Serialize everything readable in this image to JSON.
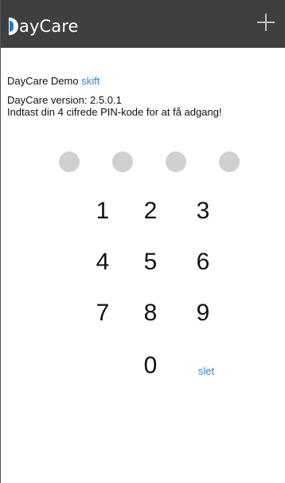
{
  "header": {
    "logo_text": "ayCare",
    "logo_icon": "daycare-logo-icon",
    "add_icon": "plus-icon"
  },
  "account": {
    "label": "DayCare Demo",
    "switch_label": "skift"
  },
  "version_text": "DayCare version: 2.5.0.1",
  "prompt_text": "Indtast din 4 cifrede PIN-kode for at få adgang!",
  "pin": {
    "entered_digits": 0
  },
  "keypad": {
    "keys": [
      "1",
      "2",
      "3",
      "4",
      "5",
      "6",
      "7",
      "8",
      "9",
      "0"
    ],
    "delete_label": "slet"
  },
  "colors": {
    "header_bg": "#3f3f3f",
    "accent": "#2f86d6",
    "pin_dot": "#d0d0d0"
  }
}
